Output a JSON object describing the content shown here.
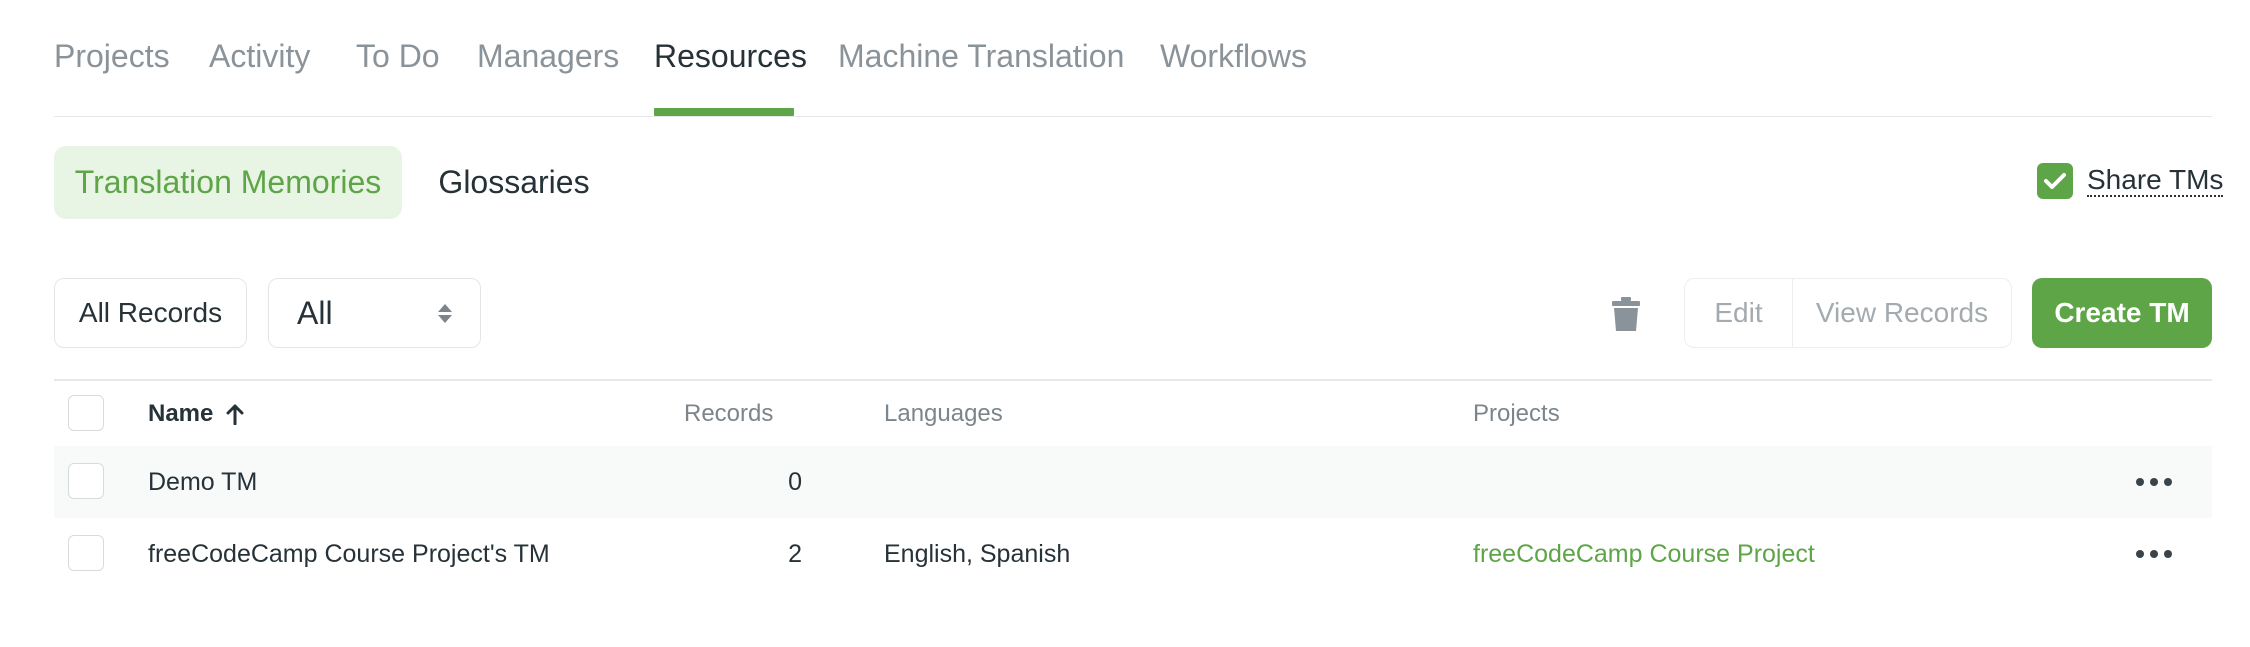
{
  "top_tabs": [
    {
      "label": "Projects"
    },
    {
      "label": "Activity"
    },
    {
      "label": "To Do"
    },
    {
      "label": "Managers"
    },
    {
      "label": "Resources",
      "active": true
    },
    {
      "label": "Machine Translation"
    },
    {
      "label": "Workflows"
    }
  ],
  "sub_tabs": [
    {
      "label": "Translation Memories",
      "active": true
    },
    {
      "label": "Glossaries"
    }
  ],
  "share": {
    "label": "Share TMs",
    "checked": true
  },
  "toolbar": {
    "all_records_label": "All Records",
    "filter_value": "All",
    "edit_label": "Edit",
    "view_records_label": "View Records",
    "create_label": "Create TM"
  },
  "table": {
    "headers": {
      "name": "Name",
      "records": "Records",
      "languages": "Languages",
      "projects": "Projects"
    },
    "rows": [
      {
        "name": "Demo TM",
        "records": "0",
        "languages": "",
        "projects": ""
      },
      {
        "name": "freeCodeCamp Course Project's TM",
        "records": "2",
        "languages": "English, Spanish",
        "projects": "freeCodeCamp Course Project"
      }
    ]
  },
  "colors": {
    "accent": "#5ea547",
    "accent_light": "#e8f4e4",
    "text": "#263238",
    "muted": "#8a9399"
  }
}
